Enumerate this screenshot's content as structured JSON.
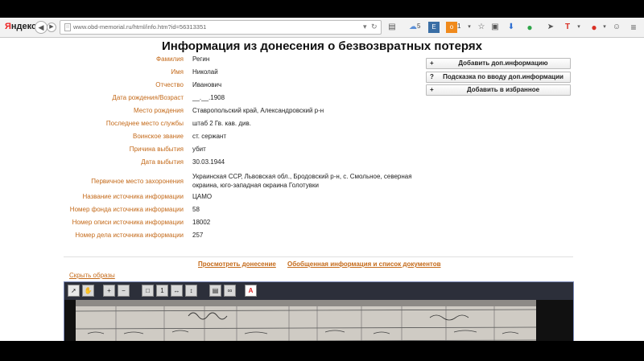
{
  "browser": {
    "logo_main": "Яндекс",
    "url": "www.obd-memorial.ru/html/info.htm?id=56313351",
    "ext_count_1": "5",
    "ext_count_2": "1"
  },
  "page": {
    "title": "Информация из донесения о безвозвратных потерях",
    "fields": [
      {
        "label": "Фамилия",
        "value": "Регин"
      },
      {
        "label": "Имя",
        "value": "Николай"
      },
      {
        "label": "Отчество",
        "value": "Иванович"
      },
      {
        "label": "Дата рождения/Возраст",
        "value": "__.__.1908"
      },
      {
        "label": "Место рождения",
        "value": "Ставропольский край, Александровский р-н"
      },
      {
        "label": "Последнее место службы",
        "value": "штаб 2 Гв. кав. див."
      },
      {
        "label": "Воинское звание",
        "value": "ст. сержант"
      },
      {
        "label": "Причина выбытия",
        "value": "убит"
      },
      {
        "label": "Дата выбытия",
        "value": "30.03.1944"
      },
      {
        "label": "Первичное место захоронения",
        "value": "Украинская ССР, Львовская обл., Бродовский р-н, с. Смольное, северная окраина, юго-западная окраина Голотувки"
      },
      {
        "label": "Название источника информации",
        "value": "ЦАМО"
      },
      {
        "label": "Номер фонда источника информации",
        "value": "58"
      },
      {
        "label": "Номер описи источника информации",
        "value": "18002"
      },
      {
        "label": "Номер дела источника информации",
        "value": "257"
      }
    ],
    "side_buttons": [
      {
        "symbol": "+",
        "label": "Добавить доп.информацию"
      },
      {
        "symbol": "?",
        "label": "Подсказка по вводу доп.информации"
      },
      {
        "symbol": "+",
        "label": "Добавить в избранное"
      }
    ],
    "link_view_report": "Просмотреть донесение",
    "link_summary": "Обобщенная информация и список документов",
    "link_hide_images": "Скрыть образы"
  }
}
